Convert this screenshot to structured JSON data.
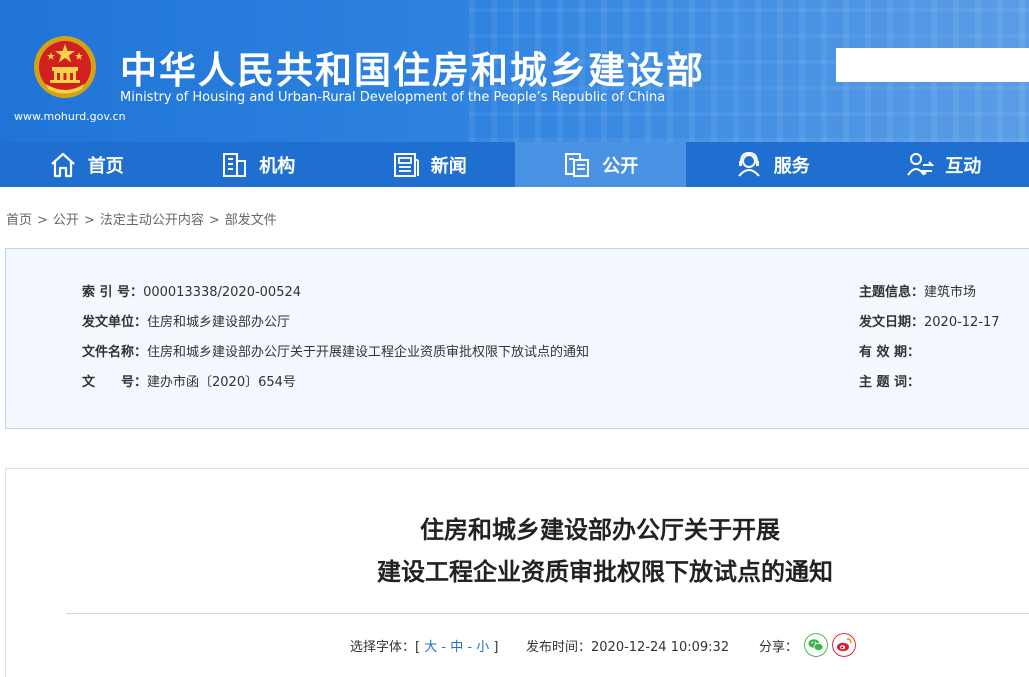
{
  "header": {
    "site_name_cn": "中华人民共和国住房和城乡建设部",
    "site_name_en": "Ministry of Housing and Urban-Rural Development of the People’s Republic of China",
    "site_url": "www.mohurd.gov.cn",
    "emblem_icon": "national-emblem-icon"
  },
  "nav": {
    "items": [
      {
        "label": "首页",
        "icon": "home-icon"
      },
      {
        "label": "机构",
        "icon": "building-icon"
      },
      {
        "label": "新闻",
        "icon": "newspaper-icon"
      },
      {
        "label": "公开",
        "icon": "document-icon"
      },
      {
        "label": "服务",
        "icon": "service-person-icon"
      },
      {
        "label": "互动",
        "icon": "interaction-icon"
      }
    ],
    "active_index": 3
  },
  "breadcrumb": {
    "items": [
      "首页",
      "公开",
      "法定主动公开内容",
      "部发文件"
    ],
    "separator": ">"
  },
  "info": {
    "index_label": "索 引 号：",
    "index_value": "000013338/2020-00524",
    "issuer_label": "发文单位：",
    "issuer_value": "住房和城乡建设部办公厅",
    "filename_label": "文件名称：",
    "filename_value": "住房和城乡建设部办公厅关于开展建设工程企业资质审批权限下放试点的通知",
    "docno_label": "文　　号：",
    "docno_value": "建办市函〔2020〕654号",
    "topic_label": "主题信息：",
    "topic_value": "建筑市场",
    "date_label": "发文日期：",
    "date_value": "2020-12-17",
    "valid_label": "有 效 期：",
    "valid_value": "",
    "keywords_label": "主 题 词：",
    "keywords_value": ""
  },
  "article": {
    "title_line1": "住房和城乡建设部办公厅关于开展",
    "title_line2": "建设工程企业资质审批权限下放试点的通知",
    "font_label": "选择字体：[",
    "font_large": "大",
    "font_sep1": "-",
    "font_medium": "中",
    "font_sep2": "-",
    "font_small": "小",
    "font_close": "]",
    "publish_label": "发布时间：",
    "publish_time": "2020-12-24 10:09:32",
    "share_label": "分享："
  },
  "colors": {
    "nav_bg": "#1f6fd0",
    "nav_active": "#4a92e3",
    "wechat": "#3bb54a",
    "weibo": "#e6162d"
  }
}
